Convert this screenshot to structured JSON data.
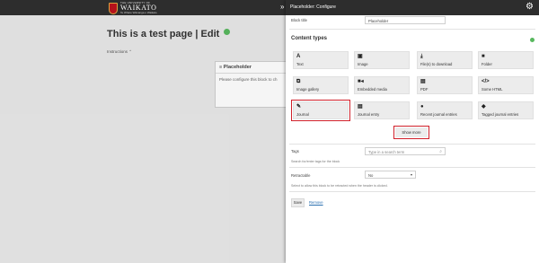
{
  "header": {
    "logo_top": "THE UNIVERSITY OF",
    "logo_main": "WAIKATO",
    "logo_sub": "Te Whare Wānanga o Waikato",
    "collapse_icon": "»"
  },
  "page": {
    "title": "This is a test page | Edit",
    "instructions": "Instructions ⌃",
    "block_title": "Placeholder",
    "block_body": "Please configure this block to ch"
  },
  "panel": {
    "title": "Placeholder: Configure",
    "block_title_label": "Block title",
    "block_title_value": "Placeholder",
    "content_types_heading": "Content types",
    "tiles": [
      {
        "icon": "A",
        "label": "Text"
      },
      {
        "icon": "▣",
        "label": "Image"
      },
      {
        "icon": "⤓",
        "label": "File(s) to download"
      },
      {
        "icon": "■",
        "label": "Folder"
      },
      {
        "icon": "⧉",
        "label": "Image gallery"
      },
      {
        "icon": "■◂",
        "label": "Embedded media"
      },
      {
        "icon": "▤",
        "label": "PDF"
      },
      {
        "icon": "</>",
        "label": "Some HTML"
      },
      {
        "icon": "✎",
        "label": "Journal"
      },
      {
        "icon": "▤",
        "label": "Journal entry"
      },
      {
        "icon": "●",
        "label": "Recent journal entries"
      },
      {
        "icon": "◆",
        "label": "Tagged journal entries"
      }
    ],
    "show_more": "Show more",
    "tags_label": "Tags",
    "tags_placeholder": "Type in a search term",
    "tags_help": "Search for/enter tags for the block",
    "retractable_label": "Retractable",
    "retractable_value": "No",
    "retractable_help": "Select to allow this block to be retracted when the header is clicked.",
    "save_label": "Save",
    "remove_label": "Remove"
  },
  "colors": {
    "dark_header": "#2d2d2d",
    "highlight_red": "#d0202a",
    "accent_green": "#58b85e",
    "tile_bg": "#ececec"
  }
}
